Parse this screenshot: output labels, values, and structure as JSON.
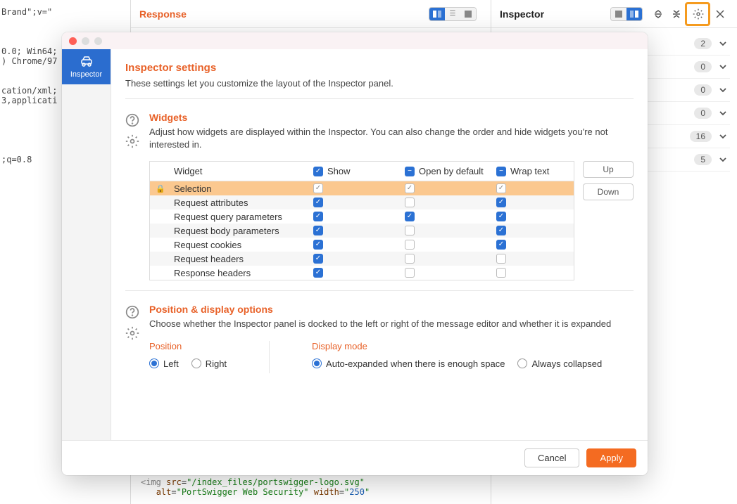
{
  "bg": {
    "response_title": "Response",
    "inspector_title": "Inspector",
    "right_counts": [
      "2",
      "0",
      "0",
      "0",
      "16",
      "5"
    ],
    "left_code": "Brand\";v=\"\n\n\n\n0.0; Win64;\n) Chrome/97\n\n\ncation/xml;\n3,applicati\n\n\n\n\n\n;q=0.8",
    "bottom_code": "<img src=\"/index_files/portswigger-logo.svg\"\n   alt=\"PortSwigger Web Security\" width=\"250\""
  },
  "modal": {
    "sidebar_tab": "Inspector",
    "title": "Inspector settings",
    "desc": "These settings let you customize the layout of the Inspector panel.",
    "widgets": {
      "title": "Widgets",
      "desc": "Adjust how widgets are displayed within the Inspector. You can also change the order and hide widgets you're not interested in.",
      "col_name": "Widget",
      "col_show": "Show",
      "col_open": "Open by default",
      "col_wrap": "Wrap text",
      "rows": [
        {
          "name": "Selection",
          "locked": true,
          "show": "light",
          "open": "light",
          "wrap": "light"
        },
        {
          "name": "Request attributes",
          "locked": false,
          "show": true,
          "open": false,
          "wrap": true
        },
        {
          "name": "Request query parameters",
          "locked": false,
          "show": true,
          "open": true,
          "wrap": true
        },
        {
          "name": "Request body parameters",
          "locked": false,
          "show": true,
          "open": false,
          "wrap": true
        },
        {
          "name": "Request cookies",
          "locked": false,
          "show": true,
          "open": false,
          "wrap": true
        },
        {
          "name": "Request headers",
          "locked": false,
          "show": true,
          "open": false,
          "wrap": false
        },
        {
          "name": "Response headers",
          "locked": false,
          "show": true,
          "open": false,
          "wrap": false
        }
      ],
      "up": "Up",
      "down": "Down"
    },
    "position": {
      "title": "Position & display options",
      "desc": "Choose whether the Inspector panel is docked to the left or right of the message editor and whether it is expanded",
      "pos_hdr": "Position",
      "left": "Left",
      "right": "Right",
      "disp_hdr": "Display mode",
      "auto": "Auto-expanded when there is enough space",
      "collapsed": "Always collapsed"
    },
    "cancel": "Cancel",
    "apply": "Apply"
  }
}
